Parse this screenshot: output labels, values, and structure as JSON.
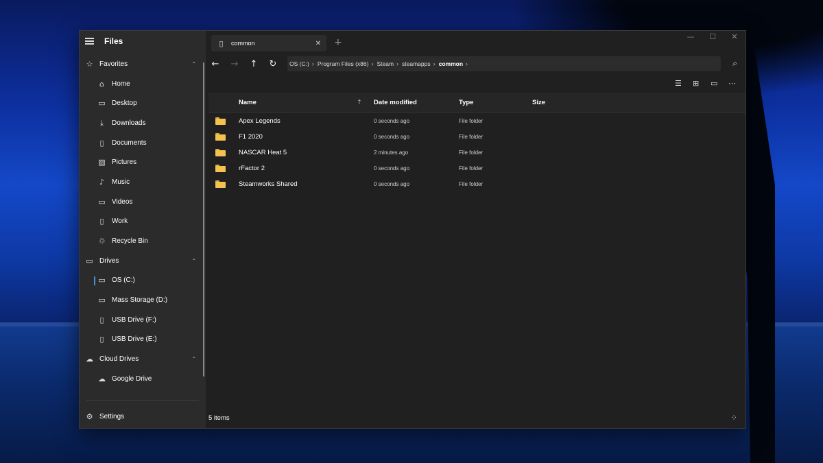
{
  "app": {
    "title": "Files"
  },
  "sidebar": {
    "favorites": {
      "label": "Favorites",
      "items": [
        {
          "label": "Home",
          "icon": "home-icon"
        },
        {
          "label": "Desktop",
          "icon": "desktop-icon"
        },
        {
          "label": "Downloads",
          "icon": "download-icon"
        },
        {
          "label": "Documents",
          "icon": "document-icon"
        },
        {
          "label": "Pictures",
          "icon": "picture-icon"
        },
        {
          "label": "Music",
          "icon": "music-icon"
        },
        {
          "label": "Videos",
          "icon": "video-icon"
        },
        {
          "label": "Work",
          "icon": "folder-icon"
        },
        {
          "label": "Recycle Bin",
          "icon": "recycle-bin-icon"
        }
      ]
    },
    "drives": {
      "label": "Drives",
      "items": [
        {
          "label": "OS (C:)",
          "icon": "drive-icon",
          "selected": true
        },
        {
          "label": "Mass Storage (D:)",
          "icon": "drive-icon"
        },
        {
          "label": "USB Drive (F:)",
          "icon": "usb-icon"
        },
        {
          "label": "USB Drive (E:)",
          "icon": "usb-icon"
        }
      ]
    },
    "cloud": {
      "label": "Cloud Drives",
      "items": [
        {
          "label": "Google Drive",
          "icon": "cloud-icon"
        }
      ]
    },
    "settings_label": "Settings"
  },
  "tabs": [
    {
      "label": "common",
      "active": true
    }
  ],
  "address": {
    "crumbs": [
      "OS (C:)",
      "Program Files (x86)",
      "Steam",
      "steamapps",
      "common"
    ]
  },
  "list": {
    "columns": {
      "name": "Name",
      "date": "Date modified",
      "type": "Type",
      "size": "Size"
    },
    "sort": "Name ascending",
    "rows": [
      {
        "name": "Apex Legends",
        "date": "0 seconds ago",
        "type": "File folder",
        "size": ""
      },
      {
        "name": "F1 2020",
        "date": "0 seconds ago",
        "type": "File folder",
        "size": ""
      },
      {
        "name": "NASCAR Heat 5",
        "date": "2 minutes ago",
        "type": "File folder",
        "size": ""
      },
      {
        "name": "rFactor 2",
        "date": "0 seconds ago",
        "type": "File folder",
        "size": ""
      },
      {
        "name": "Steamworks Shared",
        "date": "0 seconds ago",
        "type": "File folder",
        "size": ""
      }
    ]
  },
  "status": {
    "item_count": "5 items"
  },
  "colors": {
    "window_bg": "#202020",
    "sidebar_bg": "#2b2b2b",
    "accent": "#4a8fd6",
    "folder": "#f4c24f"
  }
}
